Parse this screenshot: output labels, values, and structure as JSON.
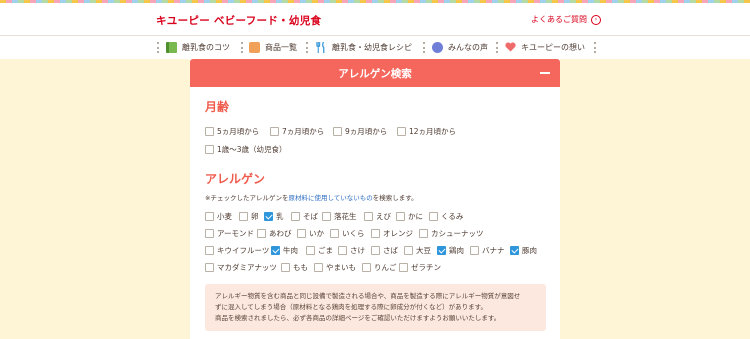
{
  "header": {
    "logo": "キユーピー ベビーフード・幼児食",
    "faq_label": "よくあるご質問",
    "faq_icon": "chevron-right-circle-icon"
  },
  "nav": {
    "items": [
      {
        "label": "離乳食のコツ",
        "icon": "book-icon"
      },
      {
        "label": "商品一覧",
        "icon": "box-icon"
      },
      {
        "label": "離乳食・幼児食レシピ",
        "icon": "cutlery-icon"
      },
      {
        "label": "みんなの声",
        "icon": "speech-bubble-icon"
      },
      {
        "label": "キユーピーの想い",
        "icon": "heart-icon"
      }
    ]
  },
  "panel": {
    "title": "アレルゲン検索",
    "age": {
      "title": "月齢",
      "options": [
        {
          "label": "5ヵ月頃から",
          "checked": false
        },
        {
          "label": "7ヵ月頃から",
          "checked": false
        },
        {
          "label": "9ヵ月頃から",
          "checked": false
        },
        {
          "label": "12ヵ月頃から",
          "checked": false
        },
        {
          "label": "1歳〜3歳（幼児食）",
          "checked": false
        }
      ]
    },
    "allergen": {
      "title": "アレルゲン",
      "note_pre": "※チェックしたアレルゲンを",
      "note_link": "原材料に使用していないもの",
      "note_post": "を検索します。",
      "options": [
        {
          "label": "小麦",
          "checked": false
        },
        {
          "label": "卵",
          "checked": false
        },
        {
          "label": "乳",
          "checked": true
        },
        {
          "label": "そば",
          "checked": false
        },
        {
          "label": "落花生",
          "checked": false
        },
        {
          "label": "えび",
          "checked": false
        },
        {
          "label": "かに",
          "checked": false
        },
        {
          "label": "くるみ",
          "checked": false
        },
        {
          "label": "アーモンド",
          "checked": false
        },
        {
          "label": "あわび",
          "checked": false
        },
        {
          "label": "いか",
          "checked": false
        },
        {
          "label": "いくら",
          "checked": false
        },
        {
          "label": "オレンジ",
          "checked": false
        },
        {
          "label": "カシューナッツ",
          "checked": false
        },
        {
          "label": "キウイフルーツ",
          "checked": false
        },
        {
          "label": "牛肉",
          "checked": true
        },
        {
          "label": "ごま",
          "checked": false
        },
        {
          "label": "さけ",
          "checked": false
        },
        {
          "label": "さば",
          "checked": false
        },
        {
          "label": "大豆",
          "checked": false
        },
        {
          "label": "鶏肉",
          "checked": true
        },
        {
          "label": "バナナ",
          "checked": false
        },
        {
          "label": "豚肉",
          "checked": true
        },
        {
          "label": "マカダミアナッツ",
          "checked": false
        },
        {
          "label": "もも",
          "checked": false
        },
        {
          "label": "やまいも",
          "checked": false
        },
        {
          "label": "りんご",
          "checked": false
        },
        {
          "label": "ゼラチン",
          "checked": false
        }
      ]
    },
    "notice": {
      "line1": "アレルギー物質を含む商品と同じ設備で製造される場合や、商品を製造する際にアレルギー物質が意図せ",
      "line2": "ずに混入してしまう場合（原材料となる鶏肉を処理する際に卵成分が付くなど）があります。",
      "line3": "商品を検索されましたら、必ず各商品の詳細ページをご確認いただけますようお願いいたします。"
    }
  },
  "colors": {
    "accent": "#f5675c",
    "brand": "#d9001b",
    "background": "#fef5d6",
    "checkbox_on": "#2f96dc",
    "notice_bg": "#fde8df"
  }
}
